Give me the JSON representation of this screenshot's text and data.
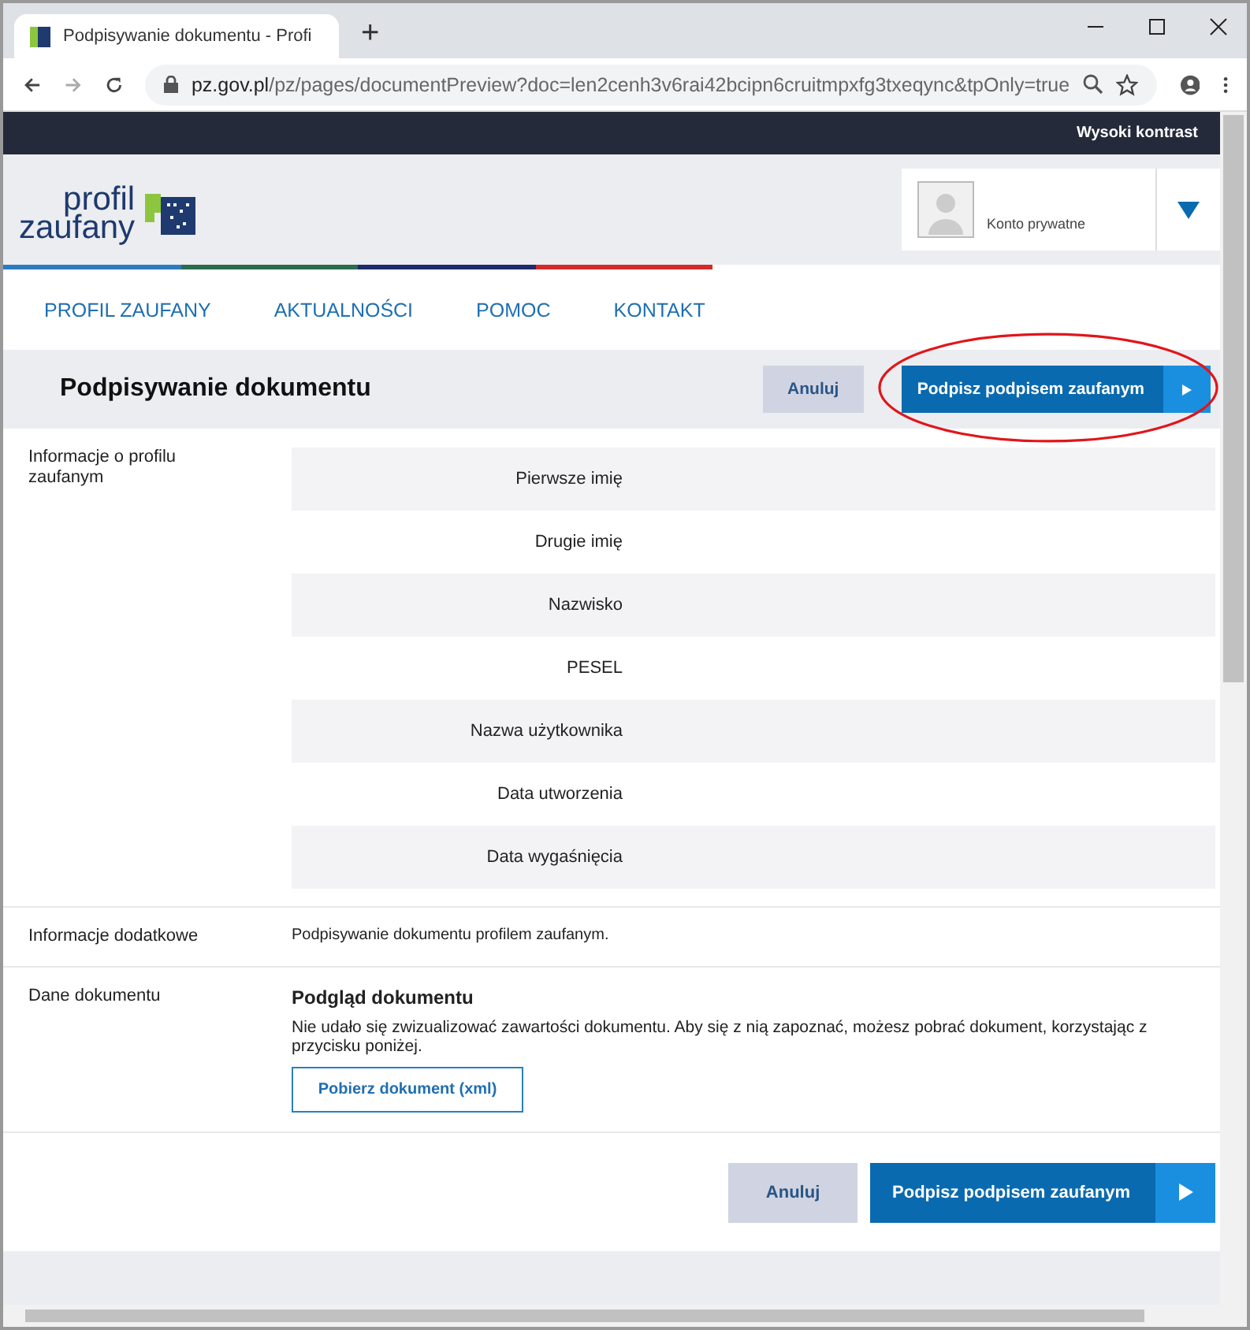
{
  "browser": {
    "tab_title": "Podpisywanie dokumentu - Profi",
    "url_host": "pz.gov.pl",
    "url_path": "/pz/pages/documentPreview?doc=len2cenh3v6rai42bcipn6cruitmpxfg3txeqync&tpOnly=true",
    "new_tab": "+"
  },
  "topbar": {
    "contrast": "Wysoki kontrast"
  },
  "logo": {
    "line1": "profil",
    "line2": "zaufany"
  },
  "account": {
    "label": "Konto prywatne"
  },
  "nav": [
    {
      "label": "PROFIL ZAUFANY"
    },
    {
      "label": "AKTUALNOŚCI"
    },
    {
      "label": "POMOC"
    },
    {
      "label": "KONTAKT"
    }
  ],
  "page_title": "Podpisywanie dokumentu",
  "cancel": "Anuluj",
  "sign": "Podpisz podpisem zaufanym",
  "footer_cancel": "Anuluj",
  "footer_sign": "Podpisz podpisem zaufanym",
  "profile_section": "Informacje o profilu zaufanym",
  "fields": [
    "Pierwsze imię",
    "Drugie imię",
    "Nazwisko",
    "PESEL",
    "Nazwa użytkownika",
    "Data utworzenia",
    "Data wygaśnięcia"
  ],
  "extra": {
    "label": "Informacje dodatkowe",
    "text": "Podpisywanie dokumentu profilem zaufanym."
  },
  "document": {
    "label": "Dane dokumentu",
    "heading": "Podgląd dokumentu",
    "text": "Nie udało się zwizualizować zawartości dokumentu. Aby się z nią zapoznać, możesz pobrać dokument, korzystając z przycisku poniżej.",
    "download": "Pobierz dokument (xml)"
  }
}
